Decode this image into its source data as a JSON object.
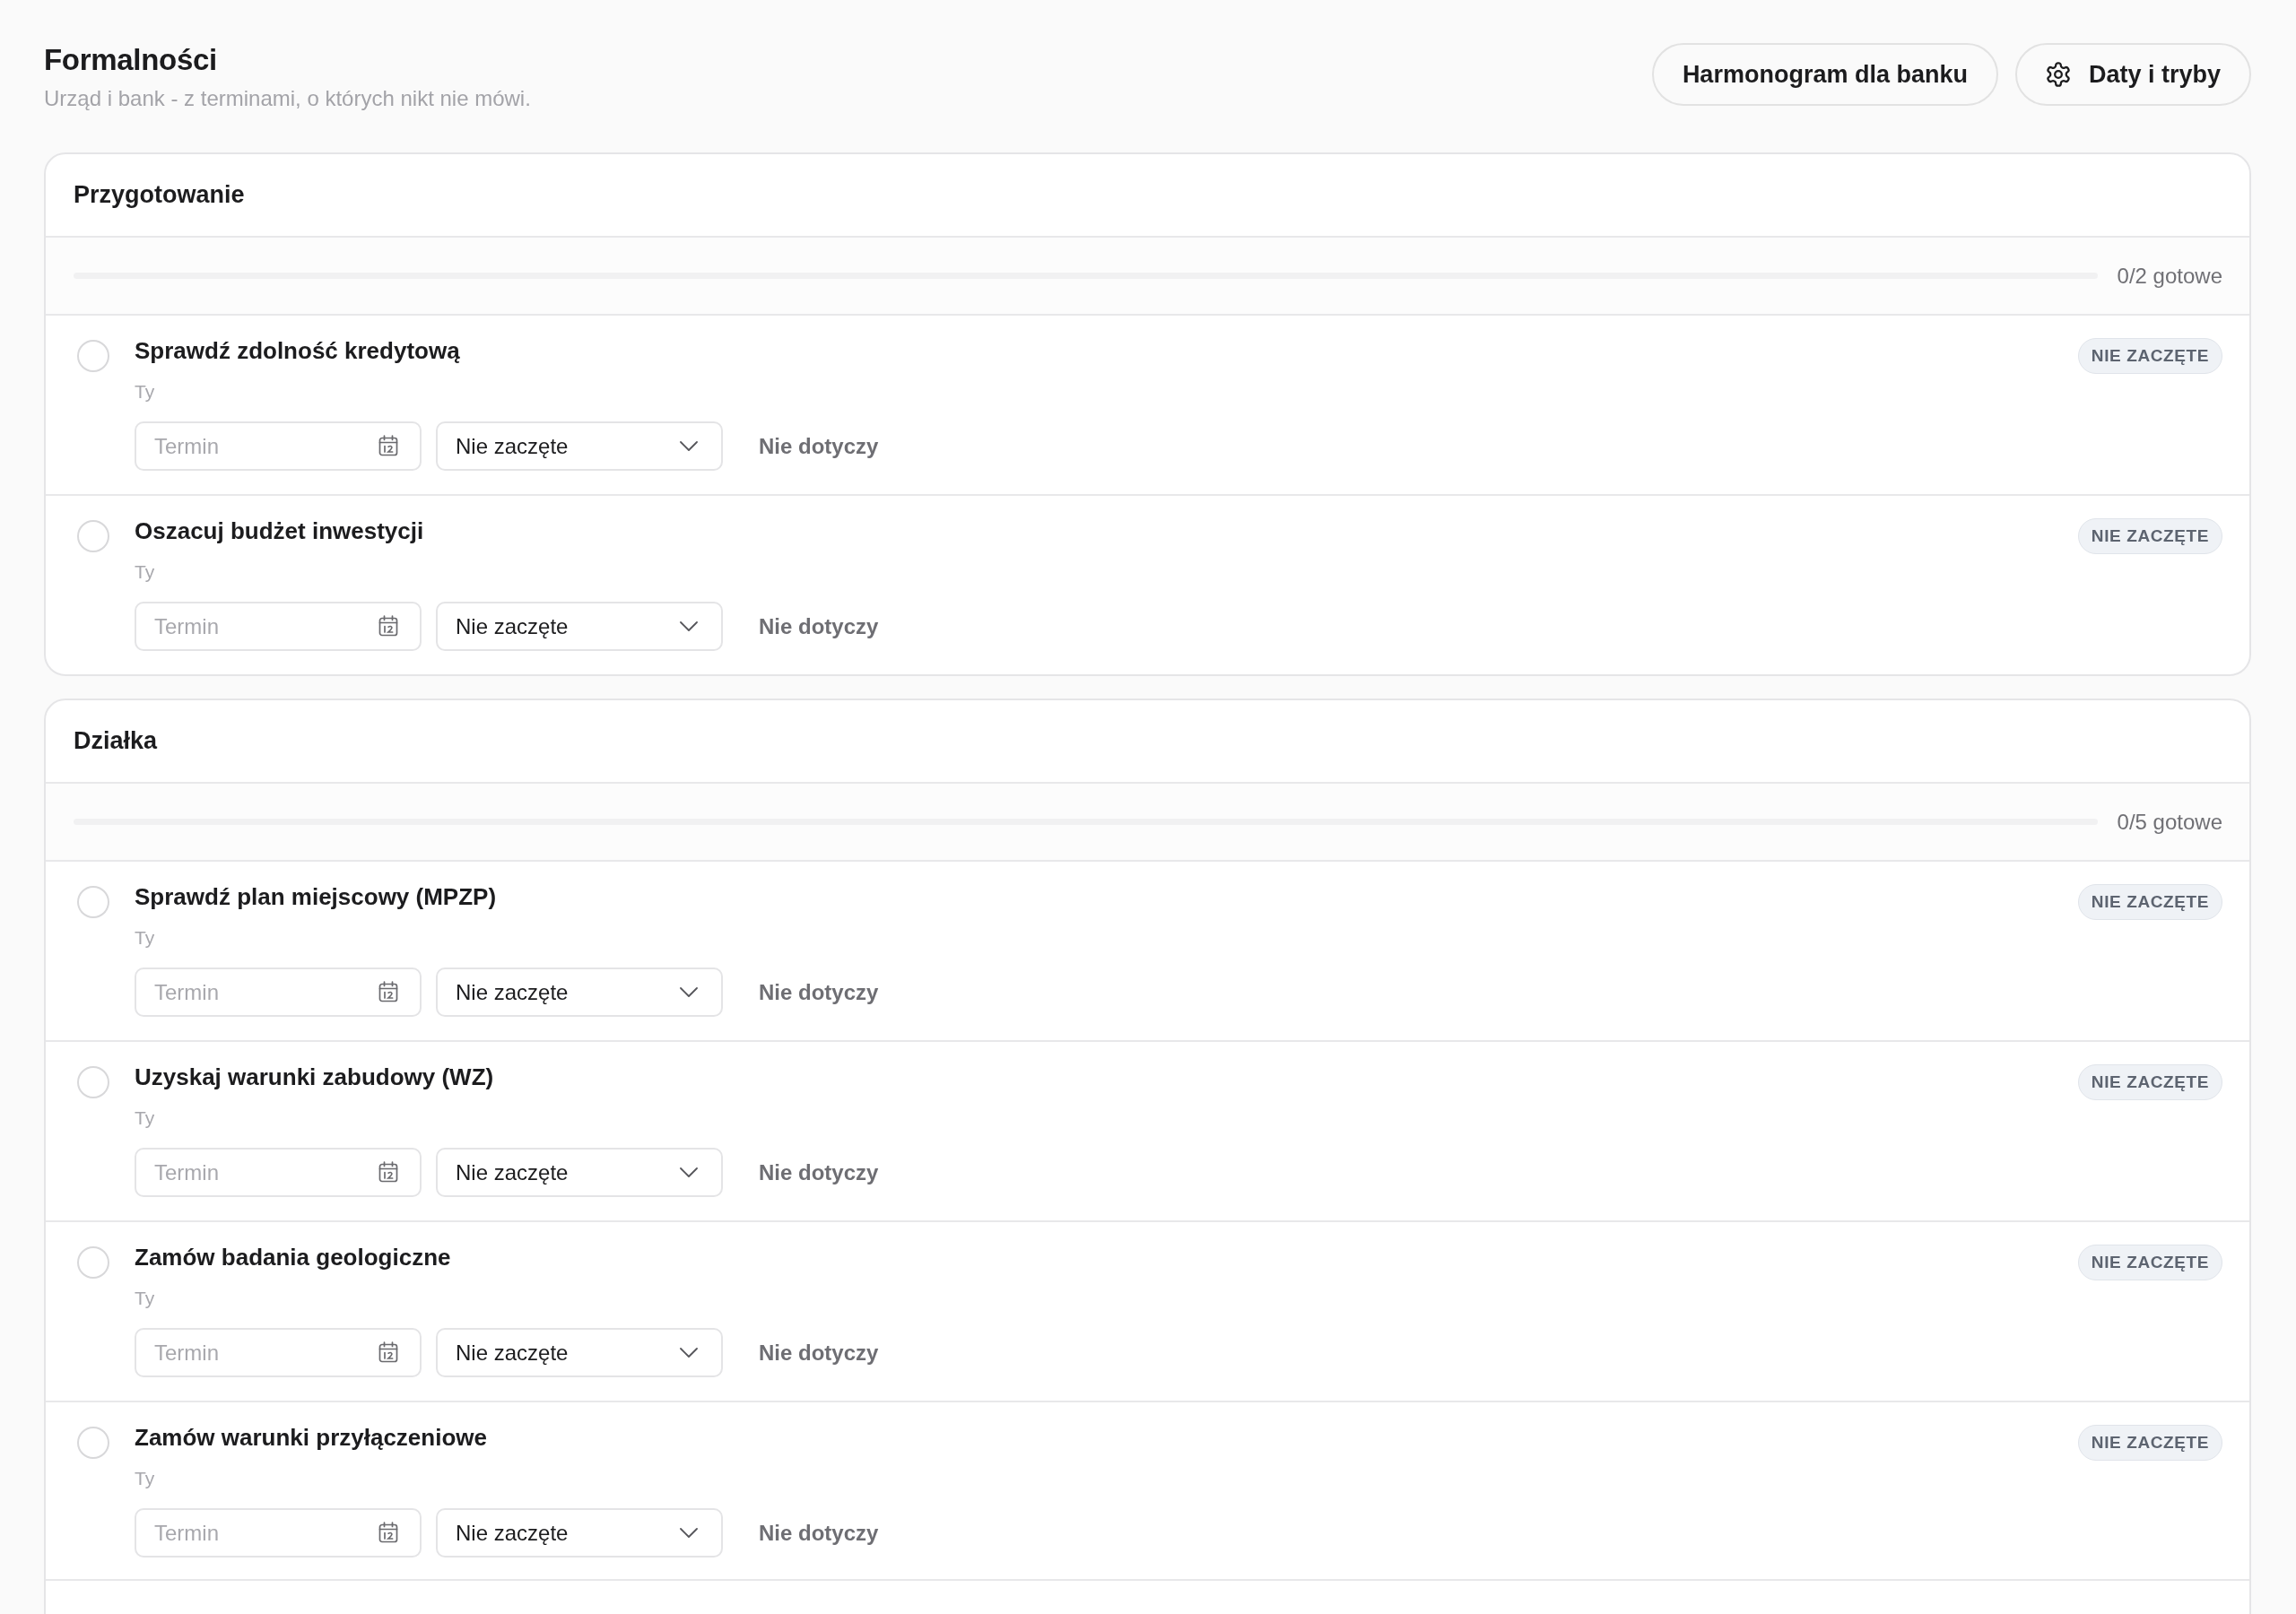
{
  "page": {
    "title": "Formalności",
    "subtitle": "Urząd i bank - z terminami, o których nikt nie mówi."
  },
  "header_buttons": [
    {
      "label": "Harmonogram dla banku",
      "kind": "plain"
    },
    {
      "label": "Daty i tryby",
      "kind": "with_icon"
    }
  ],
  "sections": [
    {
      "title": "Przygotowanie",
      "progress": {
        "level": 0,
        "label": "0/2 gotowe"
      },
      "tasks": [
        {
          "title": "Sprawdź zdolność kredytową",
          "assignee": "Ty",
          "checked": false,
          "date_field": {
            "placeholder": "Termin"
          },
          "status_select": {
            "value": "Nie zaczęte"
          },
          "not_applicable_button": "Nie dotyczy",
          "badge": "NIE ZACZĘTE"
        },
        {
          "title": "Oszacuj budżet inwestycji",
          "assignee": "Ty",
          "checked": false,
          "date_field": {
            "placeholder": "Termin"
          },
          "status_select": {
            "value": "Nie zaczęte"
          },
          "not_applicable_button": "Nie dotyczy",
          "badge": "NIE ZACZĘTE"
        }
      ]
    },
    {
      "title": "Działka",
      "progress": {
        "level": 0,
        "label": "0/5 gotowe"
      },
      "tasks": [
        {
          "title": "Sprawdź plan miejscowy (MPZP)",
          "assignee": "Ty",
          "checked": false,
          "date_field": {
            "placeholder": "Termin"
          },
          "status_select": {
            "value": "Nie zaczęte"
          },
          "not_applicable_button": "Nie dotyczy",
          "badge": "NIE ZACZĘTE"
        },
        {
          "title": "Uzyskaj warunki zabudowy (WZ)",
          "assignee": "Ty",
          "checked": false,
          "date_field": {
            "placeholder": "Termin"
          },
          "status_select": {
            "value": "Nie zaczęte"
          },
          "not_applicable_button": "Nie dotyczy",
          "badge": "NIE ZACZĘTE"
        },
        {
          "title": "Zamów badania geologiczne",
          "assignee": "Ty",
          "checked": false,
          "date_field": {
            "placeholder": "Termin"
          },
          "status_select": {
            "value": "Nie zaczęte"
          },
          "not_applicable_button": "Nie dotyczy",
          "badge": "NIE ZACZĘTE"
        },
        {
          "title": "Zamów warunki przyłączeniowe",
          "assignee": "Ty",
          "checked": false,
          "date_field": {
            "placeholder": "Termin"
          },
          "status_select": {
            "value": "Nie zaczęte"
          },
          "not_applicable_button": "Nie dotyczy",
          "badge": "NIE ZACZĘTE"
        }
      ]
    }
  ]
}
